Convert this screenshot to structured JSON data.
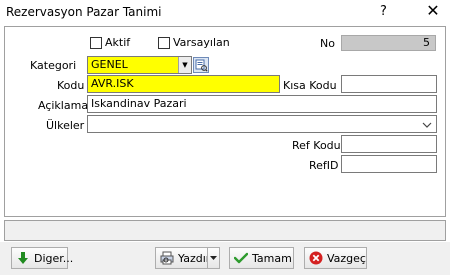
{
  "window": {
    "title": "Rezervasyon Pazar Tanimi",
    "help_glyph": "?",
    "close_glyph": "✕"
  },
  "form": {
    "aktif_label": "Aktif",
    "aktif_checked": false,
    "varsayilan_label": "Varsayılan",
    "varsayilan_checked": false,
    "no_label": "No",
    "no_value": "5",
    "kategori_label": "Kategori",
    "kategori_value": "GENEL",
    "kodu_label": "Kodu",
    "kodu_value": "AVR.ISK",
    "kisa_kodu_label": "Kısa Kodu",
    "kisa_kodu_value": "",
    "aciklama_label": "Açiklama",
    "aciklama_value": "Iskandinav Pazari",
    "ulkeler_label": "Ülkeler",
    "ulkeler_value": "",
    "ref_kodu_label": "Ref Kodu",
    "ref_kodu_value": "",
    "ref_id_label": "RefID",
    "ref_id_value": ""
  },
  "buttons": {
    "diger": "Diger...",
    "yazdir": "Yazdır",
    "tamam": "Tamam",
    "vazgec": "Vazgeç"
  },
  "colors": {
    "required_field": "#ffff00",
    "readonly_field": "#c8c8c8",
    "ok_green": "#2e9b2e",
    "cancel_red": "#d42020",
    "diger_green": "#1f8a1f"
  }
}
